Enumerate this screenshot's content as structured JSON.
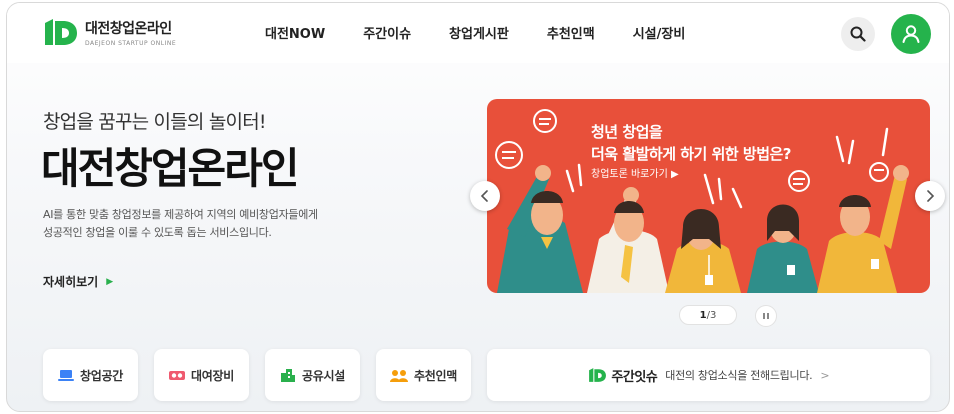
{
  "header": {
    "logo_title": "대전창업온라인",
    "logo_sub": "DAEJEON STARTUP ONLINE",
    "nav": [
      "대전NOW",
      "주간이슈",
      "창업게시판",
      "추천인맥",
      "시설/장비"
    ]
  },
  "hero": {
    "tagline": "창업을 꿈꾸는 이들의 놀이터!",
    "title": "대전창업온라인",
    "desc_line1": "AI를 통한 맞춤 창업정보를 제공하여 지역의 예비창업자들에게",
    "desc_line2": "성공적인 창업을 이룰 수 있도록 돕는 서비스입니다.",
    "more_label": "자세히보기"
  },
  "banner": {
    "headline1": "청년 창업을",
    "headline2": "더욱 활발하게 하기 위한 방법은?",
    "link_label": "창업토론 바로가기 ▶",
    "current": "1",
    "total": "/3"
  },
  "quick_links": [
    {
      "label": "창업공간",
      "icon": "laptop-icon",
      "color": "#3b82f6"
    },
    {
      "label": "대여장비",
      "icon": "equipment-icon",
      "color": "#ef5a6f"
    },
    {
      "label": "공유시설",
      "icon": "building-icon",
      "color": "#2ab04d"
    },
    {
      "label": "추천인맥",
      "icon": "people-icon",
      "color": "#f59e0b"
    }
  ],
  "weekly": {
    "brand": "주간잇슈",
    "text": "대전의 창업소식을 전해드립니다.",
    "chevron": ">"
  },
  "colors": {
    "brand_green": "#25b34c",
    "banner_red": "#e8503a"
  }
}
